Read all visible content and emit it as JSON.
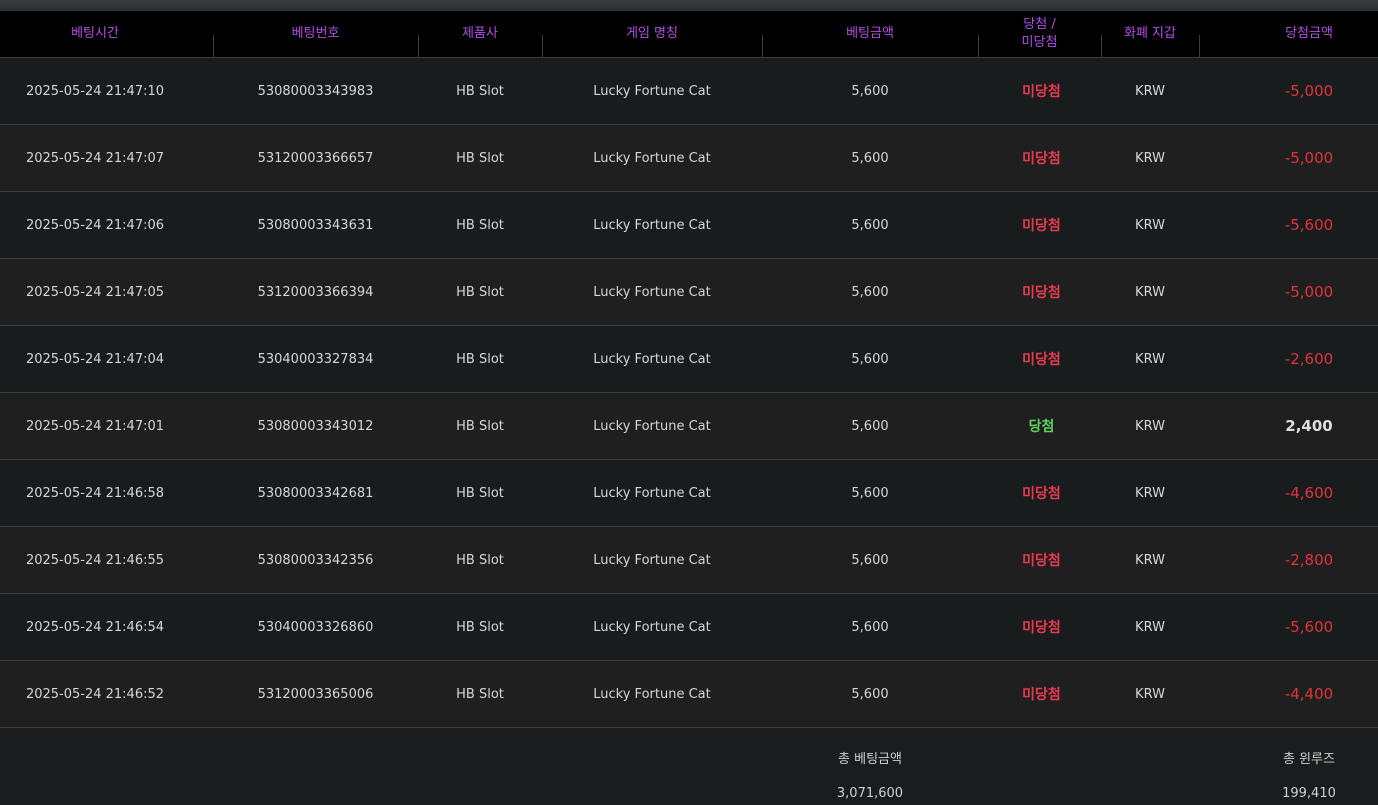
{
  "headers": {
    "bet_time": "베팅시간",
    "bet_number": "베팅번호",
    "provider": "제품사",
    "game_name": "게임 명칭",
    "bet_amount": "베팅금액",
    "result_line1": "당첨 /",
    "result_line2": "미당첨",
    "currency": "화폐 지갑",
    "win_amount": "당첨금액"
  },
  "rows": [
    {
      "time": "2025-05-24 21:47:10",
      "number": "53080003343983",
      "provider": "HB Slot",
      "game": "Lucky Fortune Cat",
      "bet": "5,600",
      "result": "미당첨",
      "currency": "KRW",
      "win": "-5,000"
    },
    {
      "time": "2025-05-24 21:47:07",
      "number": "53120003366657",
      "provider": "HB Slot",
      "game": "Lucky Fortune Cat",
      "bet": "5,600",
      "result": "미당첨",
      "currency": "KRW",
      "win": "-5,000"
    },
    {
      "time": "2025-05-24 21:47:06",
      "number": "53080003343631",
      "provider": "HB Slot",
      "game": "Lucky Fortune Cat",
      "bet": "5,600",
      "result": "미당첨",
      "currency": "KRW",
      "win": "-5,600"
    },
    {
      "time": "2025-05-24 21:47:05",
      "number": "53120003366394",
      "provider": "HB Slot",
      "game": "Lucky Fortune Cat",
      "bet": "5,600",
      "result": "미당첨",
      "currency": "KRW",
      "win": "-5,000"
    },
    {
      "time": "2025-05-24 21:47:04",
      "number": "53040003327834",
      "provider": "HB Slot",
      "game": "Lucky Fortune Cat",
      "bet": "5,600",
      "result": "미당첨",
      "currency": "KRW",
      "win": "-2,600"
    },
    {
      "time": "2025-05-24 21:47:01",
      "number": "53080003343012",
      "provider": "HB Slot",
      "game": "Lucky Fortune Cat",
      "bet": "5,600",
      "result": "당첨",
      "currency": "KRW",
      "win": "2,400"
    },
    {
      "time": "2025-05-24 21:46:58",
      "number": "53080003342681",
      "provider": "HB Slot",
      "game": "Lucky Fortune Cat",
      "bet": "5,600",
      "result": "미당첨",
      "currency": "KRW",
      "win": "-4,600"
    },
    {
      "time": "2025-05-24 21:46:55",
      "number": "53080003342356",
      "provider": "HB Slot",
      "game": "Lucky Fortune Cat",
      "bet": "5,600",
      "result": "미당첨",
      "currency": "KRW",
      "win": "-2,800"
    },
    {
      "time": "2025-05-24 21:46:54",
      "number": "53040003326860",
      "provider": "HB Slot",
      "game": "Lucky Fortune Cat",
      "bet": "5,600",
      "result": "미당첨",
      "currency": "KRW",
      "win": "-5,600"
    },
    {
      "time": "2025-05-24 21:46:52",
      "number": "53120003365006",
      "provider": "HB Slot",
      "game": "Lucky Fortune Cat",
      "bet": "5,600",
      "result": "미당첨",
      "currency": "KRW",
      "win": "-4,400"
    }
  ],
  "footer": {
    "total_bet_label": "총 베팅금액",
    "total_bet_value": "3,071,600",
    "total_winloss_label": "총 윈루즈",
    "total_winloss_value": "199,410"
  },
  "colors": {
    "header_text": "#b04fe6",
    "lose": "#e83a4f",
    "win": "#5fd35a",
    "negative_amount": "#e0333a"
  }
}
